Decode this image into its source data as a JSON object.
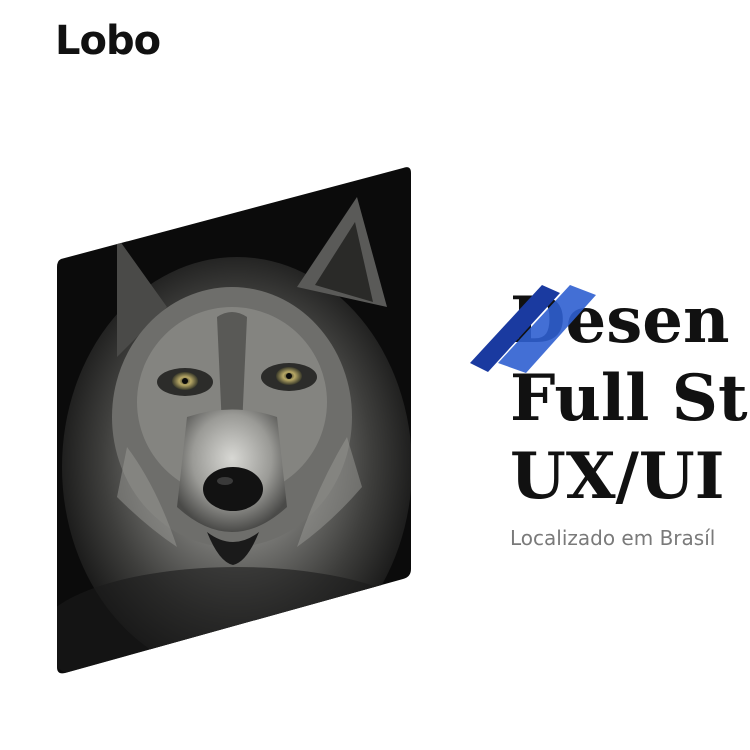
{
  "header": {
    "logo_text": "Lobo"
  },
  "hero": {
    "photo_subject": "wolf-portrait",
    "title_lines": [
      "Desen",
      "Full St",
      "UX/UI"
    ],
    "location": "Localizado em Brasíl"
  },
  "colors": {
    "accent_dark": "#1a3aa0",
    "accent_light": "#2f5fd0",
    "text": "#111111",
    "muted": "#7a7a7a"
  }
}
